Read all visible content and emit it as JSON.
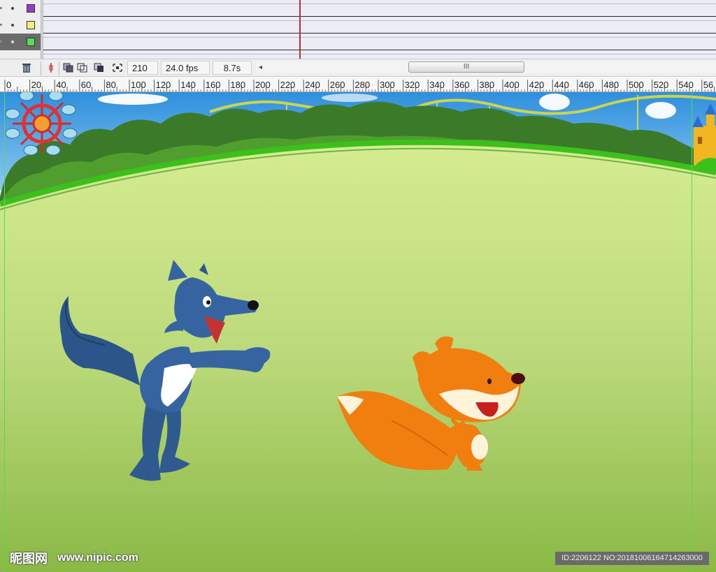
{
  "timeline": {
    "layers": [
      {
        "swatch_color": "#9a38c8"
      },
      {
        "swatch_color": "#f2ee7a"
      },
      {
        "swatch_color": "#53de5c"
      }
    ],
    "current_frame": "210",
    "frame_rate": "24.0 fps",
    "elapsed_time": "8.7s",
    "scroll_thumb_glyph": "III",
    "scroll_left_glyph": "◂",
    "icons": [
      "trash-icon",
      "center-frame-icon",
      "onion-skin-icon",
      "onion-skin-outlines-icon",
      "edit-multiple-frames-icon",
      "modify-onion-markers-icon"
    ]
  },
  "ruler": {
    "labels": [
      "0",
      "20",
      "40",
      "60",
      "80",
      "100",
      "120",
      "140",
      "160",
      "180",
      "200",
      "220",
      "240",
      "260",
      "280",
      "300",
      "320",
      "340",
      "360",
      "380",
      "400",
      "420",
      "440",
      "460",
      "480",
      "500",
      "520",
      "540",
      "56"
    ]
  },
  "stage": {
    "colors": {
      "sky": "#3d9be0",
      "grass_light": "#d4ea8e",
      "grass_dark": "#8dbc47",
      "rim": "#3cc01c",
      "guide": "#4ce04c"
    },
    "characters": [
      "wolf",
      "fox"
    ]
  },
  "watermark": {
    "logo": "昵图网",
    "site": "www.nipic.com",
    "image_id": "ID:2206122 NO:20181006164714263000"
  }
}
